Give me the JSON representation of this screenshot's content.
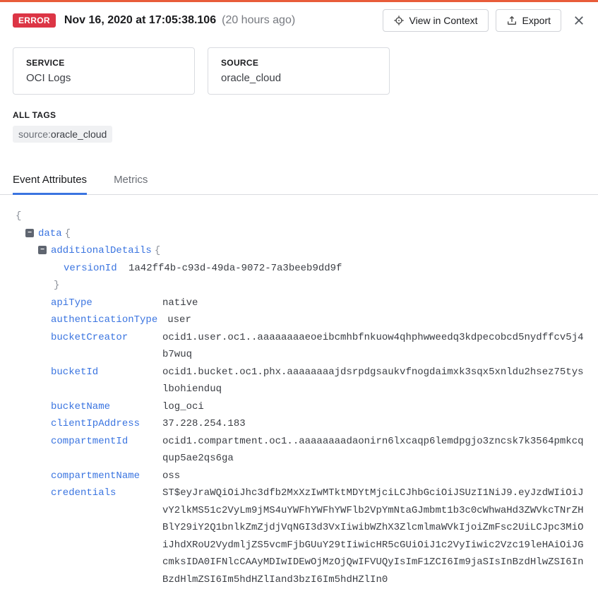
{
  "header": {
    "badge": "ERROR",
    "timestamp": "Nov 16, 2020 at 17:05:38.106",
    "relative": "(20 hours ago)",
    "view_in_context": "View in Context",
    "export": "Export"
  },
  "cards": {
    "service_label": "SERVICE",
    "service_value": "OCI Logs",
    "source_label": "SOURCE",
    "source_value": "oracle_cloud"
  },
  "alltags": {
    "label": "ALL TAGS",
    "tag_key": "source:",
    "tag_value": "oracle_cloud"
  },
  "tabs": {
    "event_attributes": "Event Attributes",
    "metrics": "Metrics"
  },
  "json": {
    "root_brace": "{",
    "data_key": "data",
    "data_brace": "{",
    "additionalDetails_key": "additionalDetails",
    "additionalDetails_brace": "{",
    "versionId_key": "versionId",
    "versionId_val": "1a42ff4b-c93d-49da-9072-7a3beeb9dd9f",
    "close_brace": "}",
    "apiType_key": "apiType",
    "apiType_val": "native",
    "authenticationType_key": "authenticationType",
    "authenticationType_val": "user",
    "bucketCreator_key": "bucketCreator",
    "bucketCreator_val": "ocid1.user.oc1..aaaaaaaaeoeibcmhbfnkuow4qhphwweedq3kdpecobcd5nydffcv5j4b7wuq",
    "bucketId_key": "bucketId",
    "bucketId_val": "ocid1.bucket.oc1.phx.aaaaaaaajdsrpdgsaukvfnogdaimxk3sqx5xnldu2hsez75tyslbohienduq",
    "bucketName_key": "bucketName",
    "bucketName_val": "log_oci",
    "clientIpAddress_key": "clientIpAddress",
    "clientIpAddress_val": "37.228.254.183",
    "compartmentId_key": "compartmentId",
    "compartmentId_val": "ocid1.compartment.oc1..aaaaaaaadaonirn6lxcaqp6lemdpgjo3zncsk7k3564pmkcqqup5ae2qs6ga",
    "compartmentName_key": "compartmentName",
    "compartmentName_val": "oss",
    "credentials_key": "credentials",
    "credentials_val": "ST$eyJraWQiOiJhc3dfb2MxXzIwMTktMDYtMjciLCJhbGciOiJSUzI1NiJ9.eyJzdWIiOiJvY2lkMS51c2VyLm9jMS4uYWFhYWFhYWFlb2VpYmNtaGJmbmt1b3c0cWhwaHd3ZWVkcTNrZHBlY29iY2Q1bnlkZmZjdjVqNGI3d3VxIiwibWZhX3ZlcmlmaWVkIjoiZmFsc2UiLCJpc3MiOiJhdXRoU2VydmljZS5vcmFjbGUuY29tIiwicHR5cGUiOiJ1c2VyIiwic2Vzc19leHAiOiJGcmksIDA0IFNlcCAAyMDIwIDEwOjMzOjQwIFVUQyIsImF1ZCI6Im9jaSIsInBzdHlwZSI6InBzdHlmZSI6Im5hdHZlIand3bzI6Im5hdHZlIn0"
  }
}
